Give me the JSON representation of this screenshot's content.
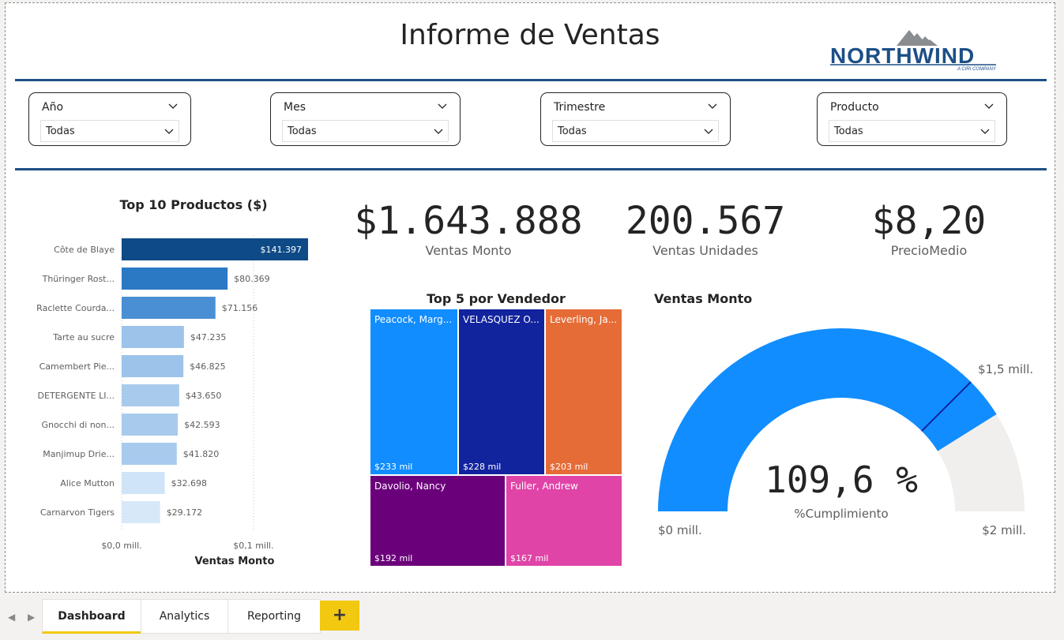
{
  "report": {
    "title": "Informe de Ventas",
    "logo": {
      "name": "NORTHWIND",
      "tagline": "A CIRI COMPANY"
    }
  },
  "slicers": [
    {
      "label": "Año",
      "value": "Todas"
    },
    {
      "label": "Mes",
      "value": "Todas"
    },
    {
      "label": "Trimestre",
      "value": "Todas"
    },
    {
      "label": "Producto",
      "value": "Todas"
    }
  ],
  "kpis": [
    {
      "value": "$1.643.888",
      "label": "Ventas Monto"
    },
    {
      "value": "200.567",
      "label": "Ventas Unidades"
    },
    {
      "value": "$8,20",
      "label": "PrecioMedio"
    }
  ],
  "chart_data": [
    {
      "type": "bar",
      "orientation": "horizontal",
      "title": "Top 10 Productos ($)",
      "xlabel": "Ventas Monto",
      "ylabel": "",
      "categories": [
        "Côte de Blaye",
        "Thüringer Rost...",
        "Raclette Courda...",
        "Tarte au sucre",
        "Camembert Pie...",
        "DETERGENTE LI...",
        "Gnocchi di non...",
        "Manjimup Drie...",
        "Alice Mutton",
        "Carnarvon Tigers"
      ],
      "values": [
        141397,
        80369,
        71156,
        47235,
        46825,
        43650,
        42593,
        41820,
        32698,
        29172
      ],
      "value_labels": [
        "$141.397",
        "$80.369",
        "$71.156",
        "$47.235",
        "$46.825",
        "$43.650",
        "$42.593",
        "$41.820",
        "$32.698",
        "$29.172"
      ],
      "bar_colors": [
        "#0e4a86",
        "#2b78c5",
        "#4a8fd3",
        "#9cc3ea",
        "#9cc3ea",
        "#a8cbed",
        "#a8cbed",
        "#a8cbed",
        "#d0e4f7",
        "#d7e9f9"
      ],
      "xlim": [
        0,
        141397
      ],
      "x_ticks": [
        {
          "value": 0,
          "label": "$0,0 mill."
        },
        {
          "value": 100000,
          "label": "$0,1 mill."
        }
      ]
    },
    {
      "type": "treemap",
      "title": "Top 5 por Vendedor",
      "items": [
        {
          "name": "Peacock, Marg...",
          "value_label": "$233 mil",
          "color": "#118dff"
        },
        {
          "name": "VELASQUEZ O...",
          "value_label": "$228 mil",
          "color": "#12239e"
        },
        {
          "name": "Leverling, Ja...",
          "value_label": "$203 mil",
          "color": "#e66c37"
        },
        {
          "name": "Davolio, Nancy",
          "value_label": "$192 mil",
          "color": "#6b007b"
        },
        {
          "name": "Fuller, Andrew",
          "value_label": "$167 mil",
          "color": "#e044a7"
        }
      ]
    },
    {
      "type": "gauge",
      "title": "Ventas Monto",
      "value_label": "109,6 %",
      "subtitle": "%Cumplimiento",
      "min_label": "$0 mill.",
      "max_label": "$2 mill.",
      "target_label": "$1,5 mill.",
      "min": 0,
      "max": 2,
      "value": 1.644,
      "target": 1.5,
      "fill_color": "#118dff",
      "track_color": "#f0efee",
      "target_color": "#12239e"
    }
  ],
  "tabs": {
    "items": [
      {
        "label": "Dashboard",
        "active": true
      },
      {
        "label": "Analytics",
        "active": false
      },
      {
        "label": "Reporting",
        "active": false
      }
    ],
    "add_label": "+"
  }
}
